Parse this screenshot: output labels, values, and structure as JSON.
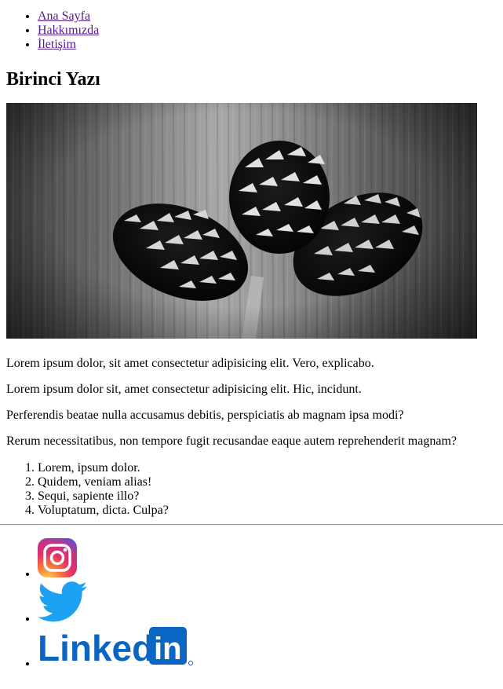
{
  "nav": {
    "items": [
      {
        "label": "Ana Sayfa"
      },
      {
        "label": "Hakkımızda"
      },
      {
        "label": "İletişim"
      }
    ],
    "link_color": "#551a8b"
  },
  "post": {
    "title": "Birinci Yazı",
    "image": {
      "subject": "pine-cones-photo",
      "style": "black-and-white"
    },
    "paragraphs": [
      "Lorem ipsum dolor, sit amet consectetur adipisicing elit. Vero, explicabo.",
      "Lorem ipsum dolor sit, amet consectetur adipisicing elit. Hic, incidunt.",
      "Perferendis beatae nulla accusamus debitis, perspiciatis ab magnam ipsa modi?",
      "Rerum necessitatibus, non tempore fugit recusandae eaque autem reprehenderit magnam?"
    ],
    "list": [
      "Lorem, ipsum dolor.",
      "Quidem, veniam alias!",
      "Sequi, sapiente illo?",
      "Voluptatum, dicta. Culpa?"
    ]
  },
  "social": {
    "instagram": {
      "icon": "instagram-icon"
    },
    "twitter": {
      "icon": "twitter-bird-icon",
      "color": "#1da1f2"
    },
    "linkedin": {
      "icon": "linkedin-logo",
      "text": "Linked",
      "badge": "in",
      "color": "#0a66c2"
    }
  }
}
